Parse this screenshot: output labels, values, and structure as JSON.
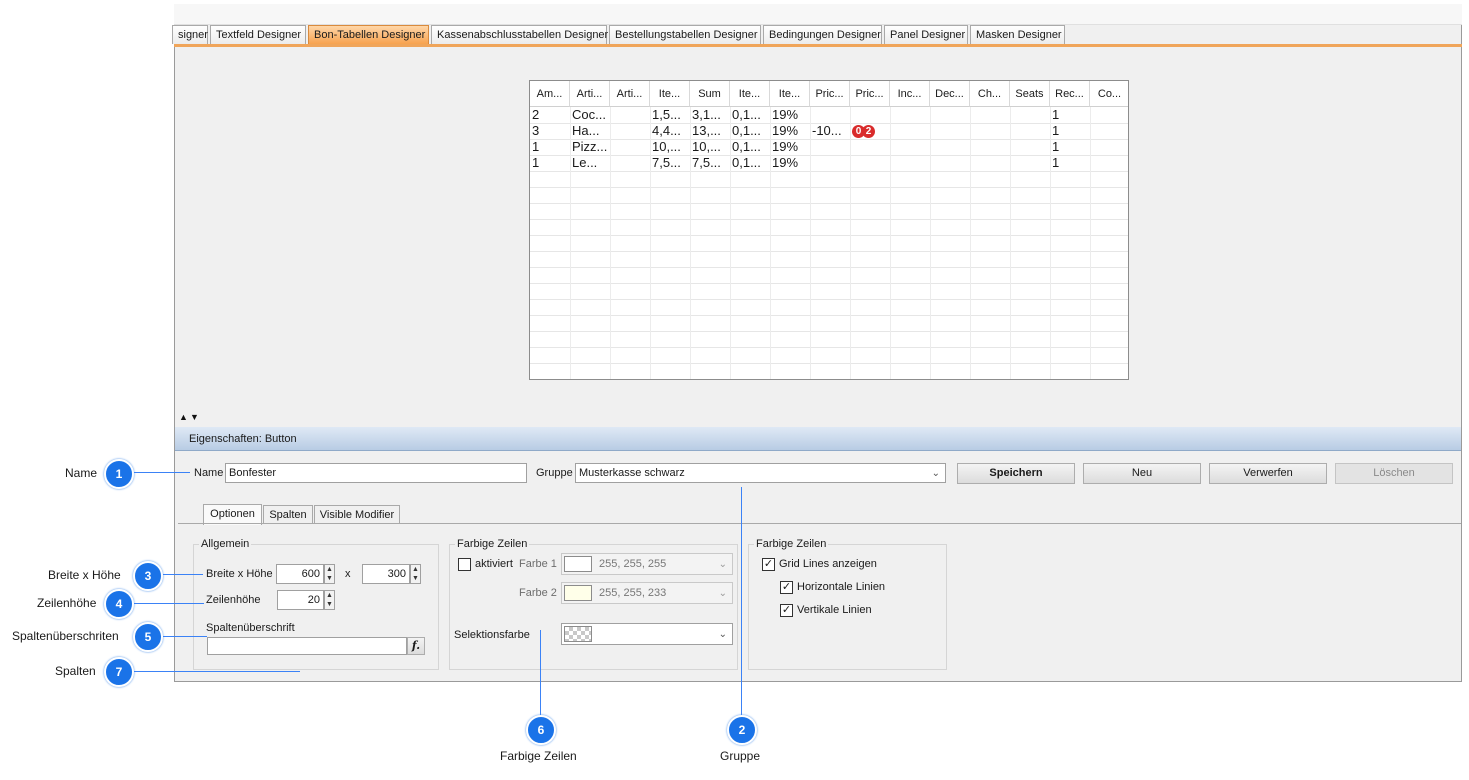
{
  "designer_tabs": [
    {
      "label": "signer",
      "active": false
    },
    {
      "label": "Textfeld Designer",
      "active": false
    },
    {
      "label": "Bon-Tabellen Designer",
      "active": true
    },
    {
      "label": "Kassenabschlusstabellen Designer",
      "active": false
    },
    {
      "label": "Bestellungstabellen Designer",
      "active": false
    },
    {
      "label": "Bedingungen Designer",
      "active": false
    },
    {
      "label": "Panel Designer",
      "active": false
    },
    {
      "label": "Masken Designer",
      "active": false
    }
  ],
  "preview_table": {
    "headers": [
      "Am...",
      "Arti...",
      "Arti...",
      "Ite...",
      "Sum",
      "Ite...",
      "Ite...",
      "Pric...",
      "Pric...",
      "Inc...",
      "Dec...",
      "Ch...",
      "Seats",
      "Rec...",
      "Co..."
    ],
    "rows": [
      [
        "2",
        "Coc...",
        "",
        "1,5...",
        "3,1...",
        "0,1...",
        "19%",
        "",
        "",
        "",
        "",
        "",
        "",
        "1",
        ""
      ],
      [
        "3",
        "Ha...",
        "",
        "4,4...",
        "13,...",
        "0,1...",
        "19%",
        "-10...",
        "",
        "",
        "",
        "",
        "",
        "1",
        ""
      ],
      [
        "1",
        "Pizz...",
        "",
        "10,...",
        "10,...",
        "0,1...",
        "19%",
        "",
        "",
        "",
        "",
        "",
        "",
        "1",
        ""
      ],
      [
        "1",
        "Le...",
        "",
        "7,5...",
        "7,5...",
        "0,1...",
        "19%",
        "",
        "",
        "",
        "",
        "",
        "",
        "1",
        ""
      ]
    ],
    "badges": [
      "0",
      "2"
    ]
  },
  "splitter": {
    "up": "▲",
    "down": "▼"
  },
  "properties": {
    "title": "Eigenschaften: Button",
    "name_label": "Name",
    "name_value": "Bonfester",
    "group_label": "Gruppe",
    "group_value": "Musterkasse schwarz",
    "save_label": "Speichern",
    "new_label": "Neu",
    "discard_label": "Verwerfen",
    "delete_label": "Löschen"
  },
  "sub_tabs": [
    "Optionen",
    "Spalten",
    "Visible Modifier"
  ],
  "general": {
    "title": "Allgemein",
    "size_label": "Breite x Höhe",
    "width": "600",
    "x_sep": "x",
    "height": "300",
    "row_height_label": "Zeilenhöhe",
    "row_height": "20",
    "column_header_label": "Spaltenüberschrift",
    "column_header_value": "",
    "formula_icon_text": "f."
  },
  "colored_rows": {
    "title": "Farbige Zeilen",
    "activated_label": "aktiviert",
    "activated": false,
    "color1_label": "Farbe 1",
    "color1_value": "255, 255, 255",
    "color1_hex": "#ffffff",
    "color2_label": "Farbe 2",
    "color2_value": "255, 255, 233",
    "color2_hex": "#ffffe9",
    "selection_label": "Selektionsfarbe"
  },
  "grid_lines": {
    "title": "Farbige Zeilen",
    "show_label": "Grid Lines anzeigen",
    "show": true,
    "horizontal_label": "Horizontale Linien",
    "horizontal": true,
    "vertical_label": "Vertikale Linien",
    "vertical": true
  },
  "callouts": [
    {
      "num": "1",
      "label": "Name"
    },
    {
      "num": "3",
      "label": "Breite x Höhe"
    },
    {
      "num": "4",
      "label": "Zeilenhöhe"
    },
    {
      "num": "5",
      "label": "Spaltenüberschriten"
    },
    {
      "num": "7",
      "label": "Spalten"
    },
    {
      "num": "6",
      "label": "Farbige Zeilen"
    },
    {
      "num": "2",
      "label": "Gruppe"
    }
  ],
  "colors": {
    "accent": "#1a73e8",
    "active_tab": "#f7a24f",
    "header_bar": "#b8cce4"
  }
}
